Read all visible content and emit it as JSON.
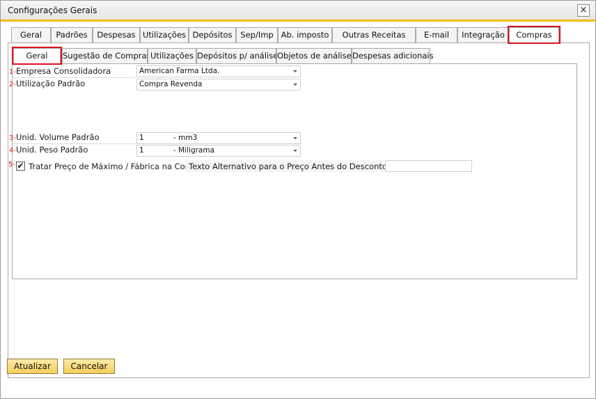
{
  "window": {
    "title": "Configurações Gerais",
    "close_symbol": "×"
  },
  "main_tabs": [
    {
      "label": "Geral"
    },
    {
      "label": "Padrões"
    },
    {
      "label": "Despesas"
    },
    {
      "label": "Utilizações"
    },
    {
      "label": "Depósitos"
    },
    {
      "label": "Sep/Imp"
    },
    {
      "label": "Ab. imposto"
    },
    {
      "label": "Outras Receitas"
    },
    {
      "label": "E-mail"
    },
    {
      "label": "Integração"
    },
    {
      "label": "Compras",
      "active": true
    }
  ],
  "sub_tabs": [
    {
      "label": "Geral",
      "active": true
    },
    {
      "label": "Sugestão de Compras"
    },
    {
      "label": "Utilizações"
    },
    {
      "label": "Depósitos p/ análise"
    },
    {
      "label": "Objetos de análise"
    },
    {
      "label": "Despesas adicionais"
    }
  ],
  "fields": {
    "empresa": {
      "num": "1-",
      "label": "Empresa Consolidadora",
      "value": "American Farma Ltda."
    },
    "utilizacao": {
      "num": "2-",
      "label": "Utilização Padrão",
      "value": "Compra Revenda"
    },
    "volume": {
      "num": "3-",
      "label": "Unid. Volume Padrão",
      "value": "1",
      "suffix": "- mm3"
    },
    "peso": {
      "num": "4-",
      "label": "Unid. Peso Padrão",
      "value": "1",
      "suffix": "- Miligrama"
    },
    "preco": {
      "num": "5-",
      "label": "Tratar Preço de Máximo / Fábrica na Compra",
      "checked": true,
      "check_glyph": "✔"
    },
    "texto_alternativo": {
      "label": "Texto Alternativo para o Preço Antes do Desconto",
      "value": ""
    }
  },
  "buttons": {
    "update": "Atualizar",
    "cancel": "Cancelar"
  },
  "colors": {
    "accent_bar": "#f2b90e",
    "highlight": "#d8141e",
    "button": "#f6cf5c"
  }
}
